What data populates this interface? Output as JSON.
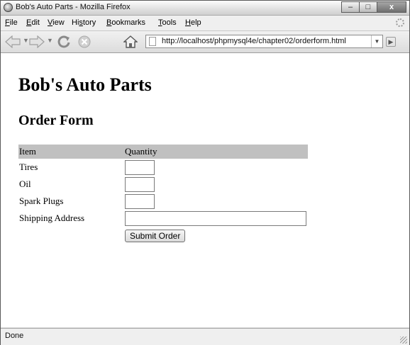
{
  "window": {
    "title": "Bob's Auto Parts - Mozilla Firefox",
    "minimize": "–",
    "maximize": "□",
    "close": "x"
  },
  "menu": [
    {
      "rest": "ile",
      "key": "F"
    },
    {
      "rest": "dit",
      "key": "E"
    },
    {
      "rest": "iew",
      "key": "V"
    },
    {
      "pre": "Hi",
      "key": "s",
      "rest": "tory"
    },
    {
      "rest": "ookmarks",
      "key": "B"
    },
    {
      "rest": "ools",
      "key": "T"
    },
    {
      "rest": "elp",
      "key": "H"
    }
  ],
  "nav": {
    "back_icon": "back-arrow-icon",
    "forward_icon": "forward-arrow-icon",
    "reload_icon": "reload-icon",
    "stop_icon": "stop-icon",
    "home_icon": "home-icon",
    "url": "http://localhost/phpmysql4e/chapter02/orderform.html"
  },
  "page": {
    "heading": "Bob's Auto Parts",
    "subheading": "Order Form",
    "table": {
      "header_item": "Item",
      "header_quantity": "Quantity",
      "rows": [
        {
          "label": "Tires",
          "value": ""
        },
        {
          "label": "Oil",
          "value": ""
        },
        {
          "label": "Spark Plugs",
          "value": ""
        }
      ],
      "shipping_label": "Shipping Address",
      "shipping_value": ""
    },
    "submit_label": "Submit Order"
  },
  "status": {
    "text": "Done"
  },
  "colors": {
    "table_header_bg": "#c0c0c0"
  }
}
